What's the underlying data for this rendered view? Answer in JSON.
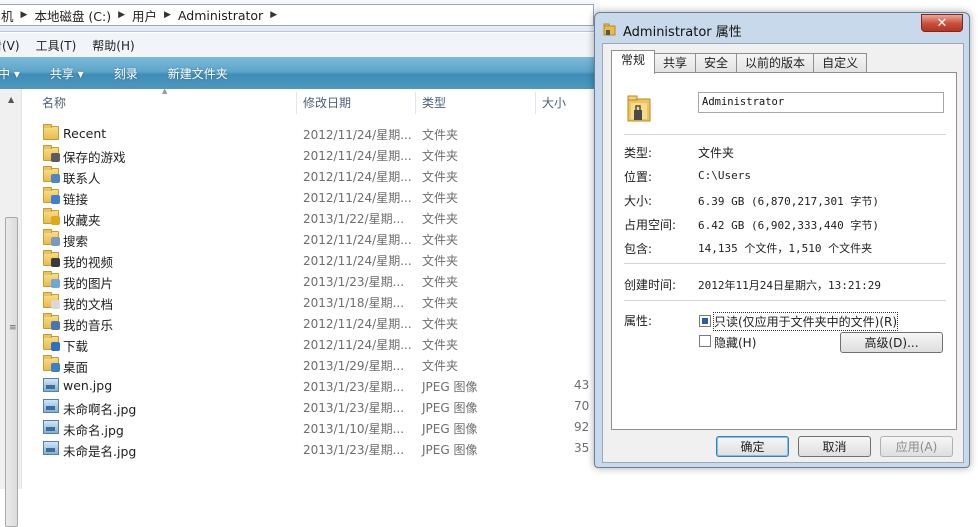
{
  "explorer": {
    "breadcrumb": [
      "机",
      "本地磁盘 (C:)",
      "用户",
      "Administrator"
    ],
    "menu": [
      "看(V)",
      "工具(T)",
      "帮助(H)"
    ],
    "toolbar": [
      "中 ▾",
      "共享 ▾",
      "刻录",
      "新建文件夹"
    ],
    "columns": {
      "name": "名称",
      "date": "修改日期",
      "type": "类型",
      "size": "大小"
    },
    "rows": [
      {
        "name": "Recent",
        "date": "2012/11/24/星期...",
        "type": "文件夹",
        "size": "",
        "icon": "folder-icon"
      },
      {
        "name": "保存的游戏",
        "date": "2012/11/24/星期...",
        "type": "文件夹",
        "size": "",
        "icon": "saved-games-folder-icon"
      },
      {
        "name": "联系人",
        "date": "2012/11/24/星期...",
        "type": "文件夹",
        "size": "",
        "icon": "contacts-folder-icon"
      },
      {
        "name": "链接",
        "date": "2012/11/24/星期...",
        "type": "文件夹",
        "size": "",
        "icon": "links-folder-icon"
      },
      {
        "name": "收藏夹",
        "date": "2013/1/22/星期...",
        "type": "文件夹",
        "size": "",
        "icon": "favorites-folder-icon"
      },
      {
        "name": "搜索",
        "date": "2012/11/24/星期...",
        "type": "文件夹",
        "size": "",
        "icon": "searches-folder-icon"
      },
      {
        "name": "我的视频",
        "date": "2012/11/24/星期...",
        "type": "文件夹",
        "size": "",
        "icon": "videos-folder-icon"
      },
      {
        "name": "我的图片",
        "date": "2013/1/23/星期...",
        "type": "文件夹",
        "size": "",
        "icon": "pictures-folder-icon"
      },
      {
        "name": "我的文档",
        "date": "2013/1/18/星期...",
        "type": "文件夹",
        "size": "",
        "icon": "documents-folder-icon"
      },
      {
        "name": "我的音乐",
        "date": "2012/11/24/星期...",
        "type": "文件夹",
        "size": "",
        "icon": "music-folder-icon"
      },
      {
        "name": "下载",
        "date": "2012/11/24/星期...",
        "type": "文件夹",
        "size": "",
        "icon": "downloads-folder-icon"
      },
      {
        "name": "桌面",
        "date": "2013/1/29/星期...",
        "type": "文件夹",
        "size": "",
        "icon": "desktop-folder-icon"
      },
      {
        "name": "wen.jpg",
        "date": "2013/1/23/星期...",
        "type": "JPEG 图像",
        "size": "43",
        "icon": "image-file-icon"
      },
      {
        "name": "未命啊名.jpg",
        "date": "2013/1/23/星期...",
        "type": "JPEG 图像",
        "size": "70",
        "icon": "image-file-icon"
      },
      {
        "name": "未命名.jpg",
        "date": "2013/1/10/星期...",
        "type": "JPEG 图像",
        "size": "92",
        "icon": "image-file-icon"
      },
      {
        "name": "未命是名.jpg",
        "date": "2013/1/23/星期...",
        "type": "JPEG 图像",
        "size": "35",
        "icon": "image-file-icon"
      }
    ]
  },
  "dialog": {
    "title": "Administrator 属性",
    "close": "✕",
    "tabs": [
      "常规",
      "共享",
      "安全",
      "以前的版本",
      "自定义"
    ],
    "name_value": "Administrator",
    "labels": {
      "type": "类型:",
      "location": "位置:",
      "size": "大小:",
      "size_on_disk": "占用空间:",
      "contains": "包含:",
      "created": "创建时间:",
      "attributes": "属性:"
    },
    "values": {
      "type": "文件夹",
      "location": "C:\\Users",
      "size": "6.39 GB (6,870,217,301 字节)",
      "size_on_disk": "6.42 GB (6,902,333,440 字节)",
      "contains": "14,135 个文件，1,510 个文件夹",
      "created": "2012年11月24日星期六，13:21:29"
    },
    "readonly_label": "只读(仅应用于文件夹中的文件)(R)",
    "hidden_label": "隐藏(H)",
    "advanced_button": "高级(D)...",
    "ok_button": "确定",
    "cancel_button": "取消",
    "apply_button": "应用(A)"
  },
  "colors": {
    "toolbar": "#4d98c1",
    "dialog_frame": "#c7d9ea",
    "close_button": "#c74e3b",
    "column_header_text": "#4c607a"
  }
}
